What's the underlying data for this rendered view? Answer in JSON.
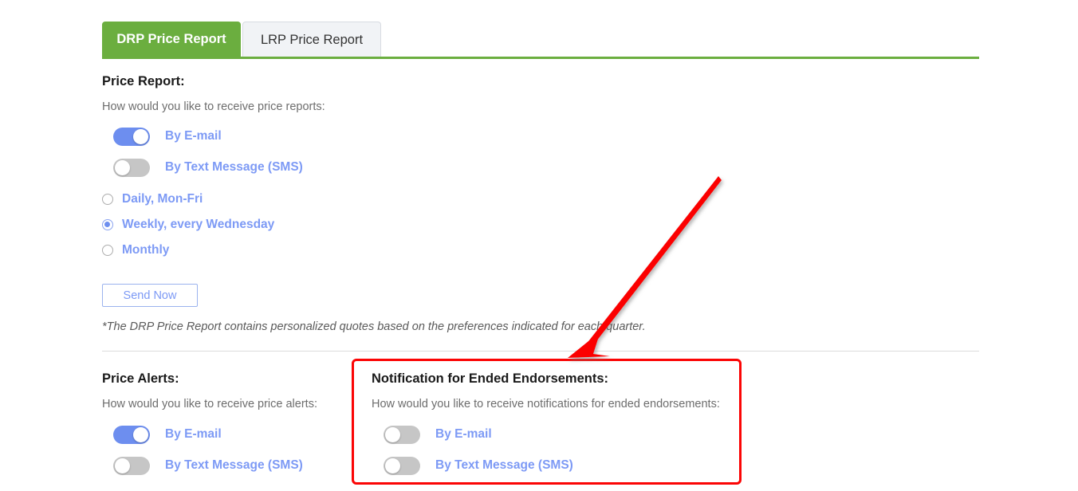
{
  "tabs": [
    {
      "label": "DRP Price Report",
      "active": true
    },
    {
      "label": "LRP Price Report",
      "active": false
    }
  ],
  "price_report": {
    "title": "Price Report:",
    "subtitle": "How would you like to receive price reports:",
    "toggles": [
      {
        "label": "By E-mail",
        "state": "on"
      },
      {
        "label": "By Text Message (SMS)",
        "state": "off"
      }
    ],
    "frequency_options": [
      {
        "label": "Daily, Mon-Fri",
        "selected": false
      },
      {
        "label": "Weekly, every Wednesday",
        "selected": true
      },
      {
        "label": "Monthly",
        "selected": false
      }
    ],
    "send_now_label": "Send Now",
    "footnote": "*The DRP Price Report contains personalized quotes based on the preferences indicated for each quarter."
  },
  "price_alerts": {
    "title": "Price Alerts:",
    "subtitle": "How would you like to receive price alerts:",
    "toggles": [
      {
        "label": "By E-mail",
        "state": "on"
      },
      {
        "label": "By Text Message (SMS)",
        "state": "off"
      }
    ]
  },
  "ended_endorsements": {
    "title": "Notification for Ended Endorsements:",
    "subtitle": "How would you like to receive notifications for ended endorsements:",
    "toggles": [
      {
        "label": "By E-mail",
        "state": "off"
      },
      {
        "label": "By Text Message (SMS)",
        "state": "off"
      }
    ]
  },
  "annotations": {
    "arrow_color": "#fb0505",
    "highlight_color": "#fb0505"
  },
  "colors": {
    "tab_active_bg": "#6bae3f",
    "toggle_on": "#6d8eef",
    "toggle_off": "#c6c6c6",
    "link_blue": "#7d9af5"
  }
}
